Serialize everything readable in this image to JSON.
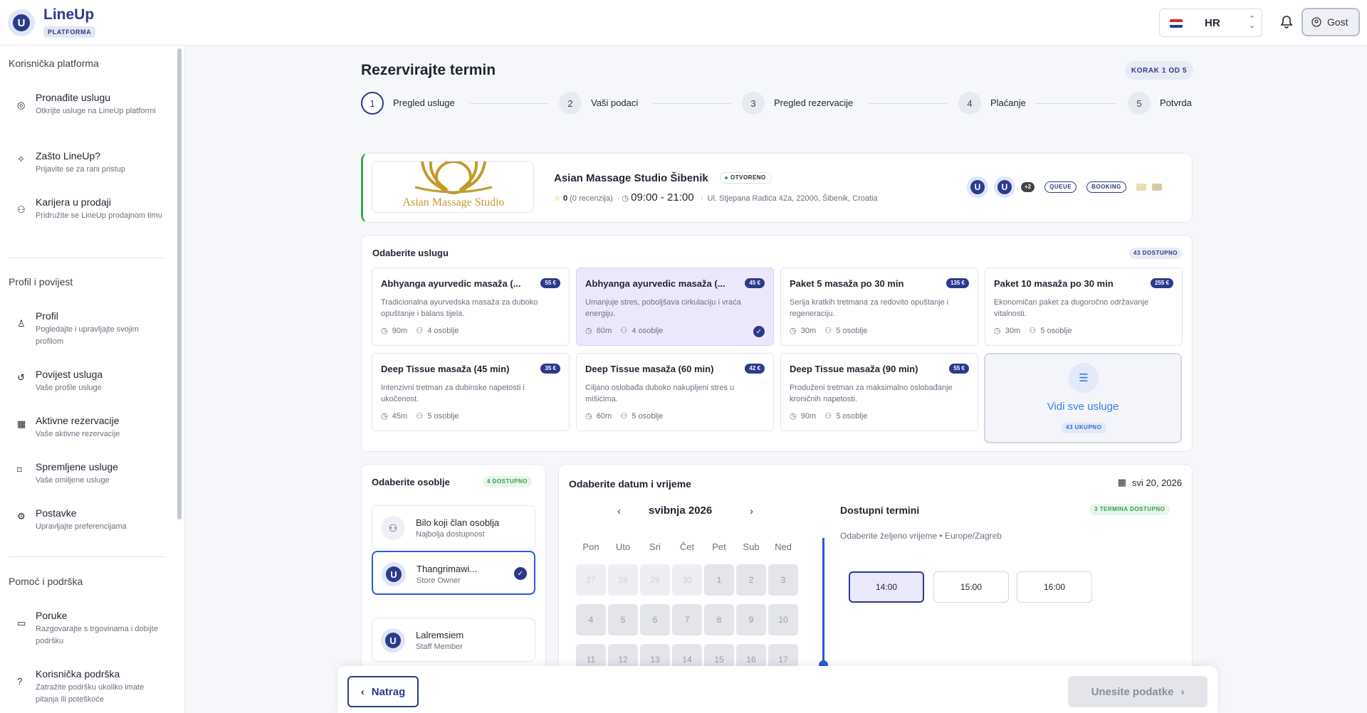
{
  "header": {
    "brand": "LineUp",
    "brand_tag": "PLATFORMA",
    "language": "HR",
    "user_label": "Gost"
  },
  "sidebar": {
    "sections": [
      {
        "title": "Korisnička platforma",
        "items": [
          {
            "title": "Pronađite uslugu",
            "desc": "Otkrijte usluge na LineUp platformi",
            "icon": "compass-icon"
          },
          {
            "title": "Zašto LineUp?",
            "desc": "Prijavite se za rani pristup",
            "icon": "sparkle-icon"
          },
          {
            "title": "Karijera u prodaji",
            "desc": "Pridružite se LineUp prodajnom timu",
            "icon": "users-icon"
          }
        ]
      },
      {
        "title": "Profil i povijest",
        "items": [
          {
            "title": "Profil",
            "desc": "Pogledajte i upravljajte svojim profilom",
            "icon": "user-icon"
          },
          {
            "title": "Povijest usluga",
            "desc": "Vaše prošle usluge",
            "icon": "history-icon"
          },
          {
            "title": "Aktivne rezervacije",
            "desc": "Vaše aktivne rezervacije",
            "icon": "calendar-icon"
          },
          {
            "title": "Spremljene usluge",
            "desc": "Vaše omiljene usluge",
            "icon": "bookmark-icon"
          },
          {
            "title": "Postavke",
            "desc": "Upravljajte preferencijama",
            "icon": "gear-icon"
          }
        ]
      },
      {
        "title": "Pomoć i podrška",
        "items": [
          {
            "title": "Poruke",
            "desc": "Razgovarajte s trgovinama i dobijte podršku",
            "icon": "message-icon"
          },
          {
            "title": "Korisnička podrška",
            "desc": "Zatražite podršku ukoliko imate pitanja ili poteškoće",
            "icon": "help-icon"
          }
        ]
      }
    ]
  },
  "booking": {
    "title": "Rezervirajte termin",
    "step_badge": "KORAK 1 OD 5",
    "steps": [
      {
        "num": "1",
        "label": "Pregled usluge"
      },
      {
        "num": "2",
        "label": "Vaši podaci"
      },
      {
        "num": "3",
        "label": "Pregled rezervacije"
      },
      {
        "num": "4",
        "label": "Plaćanje"
      },
      {
        "num": "5",
        "label": "Potvrda"
      }
    ]
  },
  "store": {
    "logo_text": "Asian Massage Studio",
    "name": "Asian Massage Studio Šibenik",
    "status": "OTVORENO",
    "rating": "0",
    "reviews": "(0 recenzija)",
    "hours": "09:00 - 21:00",
    "address": "Ul. Stjepana Radića 42a, 22000, Šibenik, Croatia",
    "extra_count": "+2",
    "tags": [
      "QUEUE",
      "BOOKING"
    ]
  },
  "services": {
    "title": "Odaberite uslugu",
    "available": "43 DOSTUPNO",
    "items": [
      {
        "name": "Abhyanga ayurvedic masaža (...",
        "price": "55 €",
        "desc": "Tradicionalna ayurvedska masaža za duboko opuštanje i balans tijela.",
        "duration": "90m",
        "staff": "4 osoblje"
      },
      {
        "name": "Abhyanga ayurvedic masaža (...",
        "price": "45 €",
        "desc": "Umanjuje stres, poboljšava cirkulaciju i vraća energiju.",
        "duration": "60m",
        "staff": "4 osoblje"
      },
      {
        "name": "Paket 5 masaža po 30 min",
        "price": "135 €",
        "desc": "Serija kratkih tretmana za redovito opuštanje i regeneraciju.",
        "duration": "30m",
        "staff": "5 osoblje"
      },
      {
        "name": "Paket 10 masaža po 30 min",
        "price": "255 €",
        "desc": "Ekonomičan paket za dugoročno održavanje vitalnosti.",
        "duration": "30m",
        "staff": "5 osoblje"
      },
      {
        "name": "Deep Tissue masaža (45 min)",
        "price": "35 €",
        "desc": "Intenzivni tretman za dubinske napetosti i ukočenost.",
        "duration": "45m",
        "staff": "5 osoblje"
      },
      {
        "name": "Deep Tissue masaža (60 min)",
        "price": "42 €",
        "desc": "Ciljano oslobađa duboko nakupljeni stres u mišićima.",
        "duration": "60m",
        "staff": "5 osoblje"
      },
      {
        "name": "Deep Tissue masaža (90 min)",
        "price": "55 €",
        "desc": "Produženi tretman za maksimalno oslobađanje kroničnih napetosti.",
        "duration": "90m",
        "staff": "5 osoblje"
      }
    ],
    "see_all_label": "Vidi sve usluge",
    "see_all_count": "43 UKUPNO"
  },
  "staff": {
    "title": "Odaberite osoblje",
    "available": "4 DOSTUPNO",
    "items": [
      {
        "name": "Bilo koji član osoblja",
        "role": "Najbolja dostupnost"
      },
      {
        "name": "Thangrimawi...",
        "role": "Store Owner"
      },
      {
        "name": "Lalremsiem",
        "role": "Staff Member"
      }
    ]
  },
  "datetime": {
    "title": "Odaberite datum i vrijeme",
    "selected_date": "svi 20, 2026",
    "month": "svibnja 2026",
    "weekdays": [
      "Pon",
      "Uto",
      "Sri",
      "Čet",
      "Pet",
      "Sub",
      "Ned"
    ],
    "days": [
      "27",
      "28",
      "29",
      "30",
      "1",
      "2",
      "3",
      "4",
      "5",
      "6",
      "7",
      "8",
      "9",
      "10",
      "11",
      "12",
      "13",
      "14",
      "15",
      "16",
      "17"
    ],
    "slots_title": "Dostupni termini",
    "slots_badge": "3 TERMINA DOSTUPNO",
    "slots_sub": "Odaberite željeno vrijeme • Europe/Zagreb",
    "slots": [
      "14:00",
      "15:00",
      "16:00"
    ]
  },
  "footer": {
    "back_label": "Natrag",
    "next_label": "Unesite podatke"
  },
  "colors": {
    "primary": "#2d3a8c",
    "open_green": "#2fa24a",
    "selected_bg": "#ece8fb",
    "link_blue": "#3b7fe0"
  }
}
